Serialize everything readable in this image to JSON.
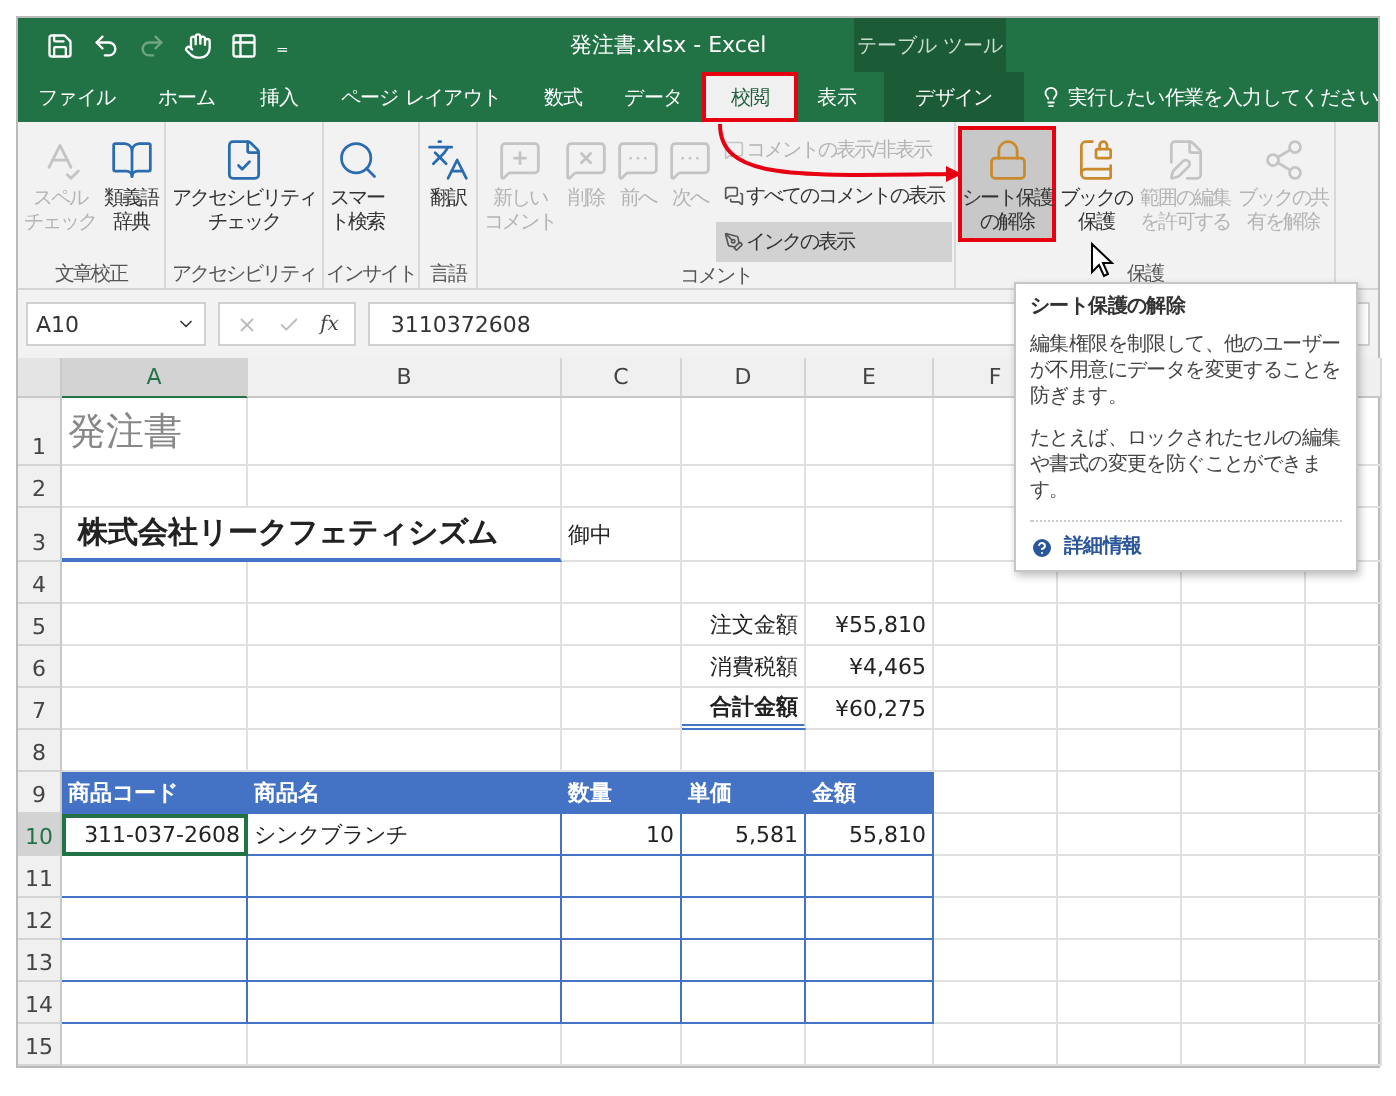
{
  "title_bar": {
    "title": "発注書.xlsx  -  Excel",
    "context_label": "テーブル ツール",
    "customize": "₌"
  },
  "tabs": [
    {
      "label": "ファイル",
      "selected": false,
      "highlighted": false,
      "kind": "normal"
    },
    {
      "label": "ホーム",
      "selected": false,
      "highlighted": false,
      "kind": "normal"
    },
    {
      "label": "挿入",
      "selected": false,
      "highlighted": false,
      "kind": "normal"
    },
    {
      "label": "ページ レイアウト",
      "selected": false,
      "highlighted": false,
      "kind": "normal"
    },
    {
      "label": "数式",
      "selected": false,
      "highlighted": false,
      "kind": "normal"
    },
    {
      "label": "データ",
      "selected": false,
      "highlighted": false,
      "kind": "normal"
    },
    {
      "label": "校閲",
      "selected": true,
      "highlighted": true,
      "kind": "normal"
    },
    {
      "label": "表示",
      "selected": false,
      "highlighted": false,
      "kind": "normal"
    },
    {
      "label": "デザイン",
      "selected": false,
      "highlighted": false,
      "kind": "context"
    }
  ],
  "tell_me": {
    "placeholder": "実行したい作業を入力してください"
  },
  "ribbon": {
    "groups": [
      {
        "label": "文章校正",
        "items": [
          {
            "kind": "large",
            "lines": [
              "スペル",
              "チェック"
            ],
            "disabled": true,
            "hovered": false,
            "highlighted": false
          },
          {
            "kind": "large",
            "lines": [
              "類義語",
              "辞典"
            ],
            "disabled": false,
            "hovered": false,
            "highlighted": false
          }
        ]
      },
      {
        "label": "アクセシビリティ",
        "items": [
          {
            "kind": "large",
            "lines": [
              "アクセシビリティ",
              "チェック"
            ],
            "disabled": false,
            "hovered": false,
            "highlighted": false
          }
        ]
      },
      {
        "label": "インサイト",
        "items": [
          {
            "kind": "large",
            "lines": [
              "スマー",
              "ト検索"
            ],
            "disabled": false,
            "hovered": false,
            "highlighted": false
          }
        ]
      },
      {
        "label": "言語",
        "items": [
          {
            "kind": "large",
            "lines": [
              "翻訳"
            ],
            "disabled": false,
            "hovered": false,
            "highlighted": false
          }
        ]
      },
      {
        "label": "コメント",
        "items": [
          {
            "kind": "large",
            "lines": [
              "新しい",
              "コメント"
            ],
            "disabled": true,
            "hovered": false,
            "highlighted": false
          },
          {
            "kind": "large",
            "lines": [
              "削除"
            ],
            "disabled": true,
            "hovered": false,
            "highlighted": false
          },
          {
            "kind": "large",
            "lines": [
              "前へ"
            ],
            "disabled": true,
            "hovered": false,
            "highlighted": false
          },
          {
            "kind": "large",
            "lines": [
              "次へ"
            ],
            "disabled": true,
            "hovered": false,
            "highlighted": false
          },
          {
            "kind": "small",
            "lines": [
              "コメントの表示/非表示"
            ],
            "disabled": true,
            "hovered": false,
            "highlighted": false
          },
          {
            "kind": "small",
            "lines": [
              "すべてのコメントの表示"
            ],
            "disabled": false,
            "hovered": false,
            "highlighted": false
          },
          {
            "kind": "small",
            "lines": [
              "インクの表示"
            ],
            "disabled": false,
            "hovered": true,
            "highlighted": false
          }
        ]
      },
      {
        "label": "保護",
        "items": [
          {
            "kind": "large",
            "lines": [
              "シート保護",
              "の解除"
            ],
            "disabled": false,
            "hovered": true,
            "highlighted": true
          },
          {
            "kind": "large",
            "lines": [
              "ブックの",
              "保護"
            ],
            "disabled": false,
            "hovered": false,
            "highlighted": false
          },
          {
            "kind": "large",
            "lines": [
              "範囲の編集",
              "を許可する"
            ],
            "disabled": true,
            "hovered": false,
            "highlighted": false
          },
          {
            "kind": "large",
            "lines": [
              "ブックの共",
              "有を解除"
            ],
            "disabled": true,
            "hovered": false,
            "highlighted": false
          }
        ]
      }
    ]
  },
  "formula_bar": {
    "name_box": "A10",
    "function_label": "fx",
    "formula": "3110372608"
  },
  "tooltip": {
    "title": "シート保護の解除",
    "paragraphs": [
      "編集権限を制限して、他のユーザーが不用意にデータを変更することを防ぎます。",
      "たとえば、ロックされたセルの編集や書式の変更を防ぐことができます。"
    ],
    "link": "詳細情報"
  },
  "sheet": {
    "columns": [
      {
        "letter": "A",
        "selected": true
      },
      {
        "letter": "B",
        "selected": false
      },
      {
        "letter": "C",
        "selected": false
      },
      {
        "letter": "D",
        "selected": false
      },
      {
        "letter": "E",
        "selected": false
      },
      {
        "letter": "F",
        "selected": false
      }
    ],
    "rows": [
      {
        "number": "1",
        "selected": false,
        "kind": "plain",
        "cells": [
          {
            "kind": "title",
            "text": "発注書",
            "selected": false
          }
        ]
      },
      {
        "number": "2",
        "selected": false,
        "kind": "plain",
        "cells": []
      },
      {
        "number": "3",
        "selected": false,
        "kind": "plain",
        "cells": [
          {
            "kind": "heading",
            "text": "株式会社リークフェティシズム",
            "selected": false
          },
          {
            "kind": "text",
            "text": "御中",
            "selected": false
          }
        ]
      },
      {
        "number": "4",
        "selected": false,
        "kind": "plain",
        "cells": []
      },
      {
        "number": "5",
        "selected": false,
        "kind": "plain",
        "cells": [
          {
            "kind": "blank",
            "selected": false
          },
          {
            "kind": "blank",
            "selected": false
          },
          {
            "kind": "blank",
            "selected": false
          },
          {
            "kind": "label",
            "text": "注文金額",
            "selected": false
          },
          {
            "kind": "number",
            "text": "¥55,810",
            "selected": false
          }
        ]
      },
      {
        "number": "6",
        "selected": false,
        "kind": "plain",
        "cells": [
          {
            "kind": "blank",
            "selected": false
          },
          {
            "kind": "blank",
            "selected": false
          },
          {
            "kind": "blank",
            "selected": false
          },
          {
            "kind": "label",
            "text": "消費税額",
            "selected": false
          },
          {
            "kind": "number",
            "text": "¥4,465",
            "selected": false
          }
        ]
      },
      {
        "number": "7",
        "selected": false,
        "kind": "plain",
        "cells": [
          {
            "kind": "blank",
            "selected": false
          },
          {
            "kind": "blank",
            "selected": false
          },
          {
            "kind": "blank",
            "selected": false
          },
          {
            "kind": "total_label",
            "text": "合計金額",
            "selected": false
          },
          {
            "kind": "number",
            "text": "¥60,275",
            "selected": false
          }
        ]
      },
      {
        "number": "8",
        "selected": false,
        "kind": "plain",
        "cells": []
      },
      {
        "number": "9",
        "selected": false,
        "kind": "table_header",
        "cells": [
          {
            "kind": "text",
            "text": "商品コード",
            "selected": false
          },
          {
            "kind": "text",
            "text": "商品名",
            "selected": false
          },
          {
            "kind": "text",
            "text": "数量",
            "selected": false
          },
          {
            "kind": "text",
            "text": "単価",
            "selected": false
          },
          {
            "kind": "text",
            "text": "金額",
            "selected": false
          }
        ]
      },
      {
        "number": "10",
        "selected": true,
        "kind": "table_body",
        "cells": [
          {
            "kind": "number",
            "text": "311-037-2608",
            "selected": true
          },
          {
            "kind": "text",
            "text": "シンクブランチ",
            "selected": false
          },
          {
            "kind": "number",
            "text": "10",
            "selected": false
          },
          {
            "kind": "number",
            "text": "5,581",
            "selected": false
          },
          {
            "kind": "number",
            "text": "55,810",
            "selected": false
          }
        ]
      },
      {
        "number": "11",
        "selected": false,
        "kind": "table_body",
        "cells": []
      },
      {
        "number": "12",
        "selected": false,
        "kind": "table_body",
        "cells": []
      },
      {
        "number": "13",
        "selected": false,
        "kind": "table_body",
        "cells": []
      },
      {
        "number": "14",
        "selected": false,
        "kind": "table_body",
        "cells": []
      },
      {
        "number": "15",
        "selected": false,
        "kind": "plain",
        "cells": []
      }
    ]
  }
}
